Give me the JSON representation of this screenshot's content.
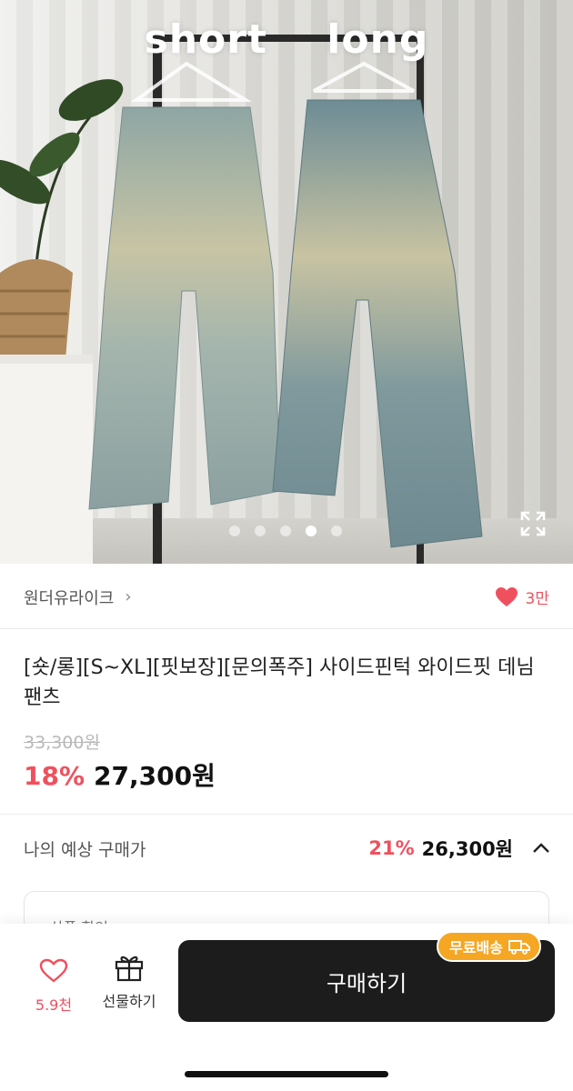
{
  "hero": {
    "overlay_text": "short    long",
    "page_indicator": {
      "total": 5,
      "active_index": 3
    }
  },
  "store": {
    "name": "원더유라이크",
    "chevron": "›",
    "likes": "3만"
  },
  "product": {
    "title": "[숏/롱][S~XL][핏보장][문의폭주] 사이드핀턱 와이드핏 데님팬츠",
    "original_price": "33,300원",
    "discount_rate": "18%",
    "price": "27,300원"
  },
  "expected_price": {
    "label": "나의 예상 구매가",
    "rate": "21%",
    "price": "26,300원"
  },
  "coupon_box": {
    "label": "상품 할인"
  },
  "bottom_bar": {
    "wish_count": "5.9천",
    "gift_label": "선물하기",
    "buy_label": "구매하기",
    "free_shipping_label": "무료배송"
  },
  "colors": {
    "accent": "#f0505e",
    "badge": "#f5a623",
    "button": "#1c1c1c"
  }
}
